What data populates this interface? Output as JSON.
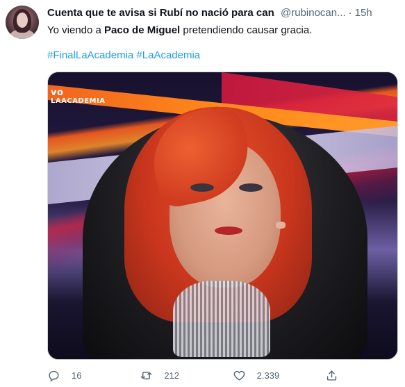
{
  "tweet": {
    "display_name": "Cuenta que te avisa si Rubí no nació para can...",
    "handle": "@rubinocan...",
    "separator": "·",
    "time": "15h",
    "text_before": "Yo viendo a ",
    "text_bold": "Paco de Miguel",
    "text_after": " pretendiendo causar gracia.",
    "hashtags": [
      "#FinalLaAcademia",
      "#LaAcademia"
    ],
    "media": {
      "logo_line1": "vo",
      "logo_line2": "LAACADEMIA"
    },
    "actions": {
      "reply_count": "16",
      "retweet_count": "212",
      "like_count": "2.339"
    }
  },
  "icons": {
    "reply": "reply-icon",
    "retweet": "retweet-icon",
    "like": "heart-icon",
    "share": "share-icon",
    "more": "more-icon"
  },
  "colors": {
    "text": "#0f1419",
    "secondary": "#536471",
    "link": "#1d9bf0"
  }
}
